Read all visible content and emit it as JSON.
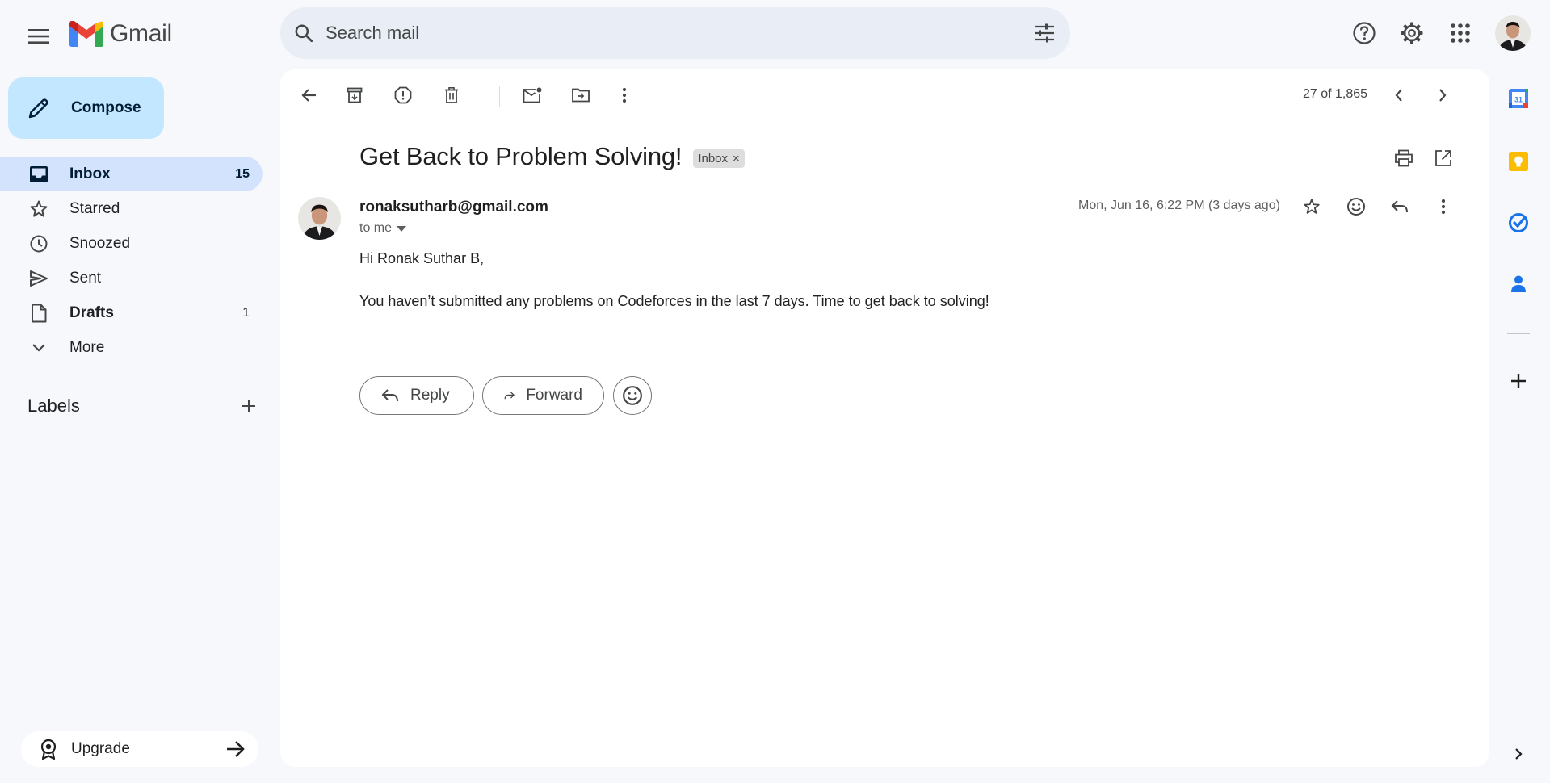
{
  "app": {
    "name": "Gmail"
  },
  "search": {
    "placeholder": "Search mail"
  },
  "sidebar": {
    "compose_label": "Compose",
    "items": [
      {
        "label": "Inbox",
        "count": "15"
      },
      {
        "label": "Starred",
        "count": ""
      },
      {
        "label": "Snoozed",
        "count": ""
      },
      {
        "label": "Sent",
        "count": ""
      },
      {
        "label": "Drafts",
        "count": "1"
      },
      {
        "label": "More",
        "count": ""
      }
    ],
    "labels_heading": "Labels",
    "upgrade_label": "Upgrade"
  },
  "toolbar": {
    "page_count": "27 of 1,865"
  },
  "email": {
    "subject": "Get Back to Problem Solving!",
    "label_chip": "Inbox",
    "label_chip_close": "×",
    "sender": "ronaksutharb@gmail.com",
    "recipient": "to me",
    "date": "Mon, Jun 16, 6:22 PM (3 days ago)",
    "greeting": "Hi Ronak Suthar B,",
    "body": "You haven’t submitted any problems on Codeforces in the last 7 days. Time to get back to solving!"
  },
  "actions": {
    "reply_label": "Reply",
    "forward_label": "Forward"
  },
  "colors": {
    "background": "#f6f8fc",
    "compose_bg": "#c2e7ff",
    "active_nav": "#d3e3fd",
    "search_bg": "#e9eef6"
  }
}
